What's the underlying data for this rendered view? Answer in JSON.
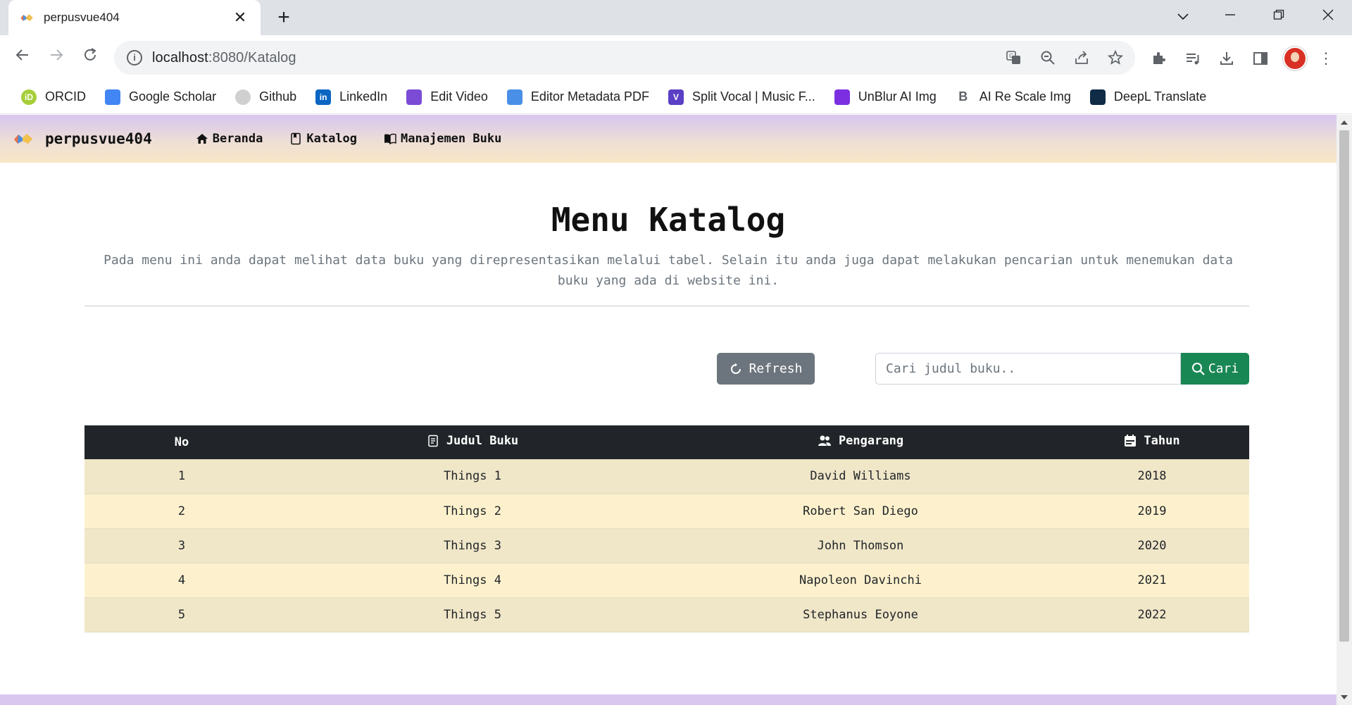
{
  "browser": {
    "tab_title": "perpusvue404",
    "tab_close": "✕",
    "new_tab": "+",
    "url_host": "localhost",
    "url_rest": ":8080/Katalog",
    "window_controls": [
      "chevron-down-icon",
      "minimize-icon",
      "restore-icon",
      "close-icon"
    ],
    "bookmarks": [
      {
        "label": "ORCID",
        "icon": "orcid-icon",
        "color": "#a6ce39",
        "glyph": "iD"
      },
      {
        "label": "Google Scholar",
        "icon": "google-scholar-icon",
        "color": "#4285f4",
        "glyph": ""
      },
      {
        "label": "Github",
        "icon": "github-icon",
        "color": "#d0d0d0",
        "glyph": ""
      },
      {
        "label": "LinkedIn",
        "icon": "linkedin-icon",
        "color": "#0a66c2",
        "glyph": "in"
      },
      {
        "label": "Edit Video",
        "icon": "edit-video-icon",
        "color": "#7b4bd6",
        "glyph": ""
      },
      {
        "label": "Editor Metadata PDF",
        "icon": "editor-metadata-icon",
        "color": "#4a8fe7",
        "glyph": ""
      },
      {
        "label": "Split Vocal | Music F...",
        "icon": "split-vocal-icon",
        "color": "#5b3fc4",
        "glyph": "V"
      },
      {
        "label": "UnBlur AI Img",
        "icon": "unblur-icon",
        "color": "#7b2fe0",
        "glyph": ""
      },
      {
        "label": "AI Re Scale Img",
        "icon": "ai-rescale-icon",
        "color": "#ffffff",
        "glyph": "B"
      },
      {
        "label": "DeepL Translate",
        "icon": "deepl-icon",
        "color": "#0f2b46",
        "glyph": ""
      }
    ]
  },
  "navbar": {
    "brand": "perpusvue404",
    "links": [
      {
        "label": "Beranda",
        "icon": "home-icon"
      },
      {
        "label": "Katalog",
        "icon": "bookmark-book-icon"
      },
      {
        "label": "Manajemen Buku",
        "icon": "open-book-icon"
      }
    ]
  },
  "main": {
    "title": "Menu Katalog",
    "description": "Pada menu ini anda dapat melihat data buku yang direpresentasikan melalui tabel. Selain itu anda juga dapat melakukan pencarian untuk menemukan data buku yang ada di website ini.",
    "refresh_label": "Refresh",
    "search_placeholder": "Cari judul buku..",
    "search_value": "",
    "search_button": "Cari"
  },
  "table": {
    "headers": [
      "No",
      "Judul Buku",
      "Pengarang",
      "Tahun"
    ],
    "rows": [
      [
        "1",
        "Things 1",
        "David Williams",
        "2018"
      ],
      [
        "2",
        "Things 2",
        "Robert San Diego",
        "2019"
      ],
      [
        "3",
        "Things 3",
        "John Thomson",
        "2020"
      ],
      [
        "4",
        "Things 4",
        "Napoleon Davinchi",
        "2021"
      ],
      [
        "5",
        "Things 5",
        "Stephanus Eoyone",
        "2022"
      ]
    ]
  },
  "colors": {
    "table_header": "#212529",
    "row_odd": "#f0e6c8",
    "row_even": "#fdf1cd",
    "refresh_button": "#6c757d",
    "search_button": "#198754"
  }
}
